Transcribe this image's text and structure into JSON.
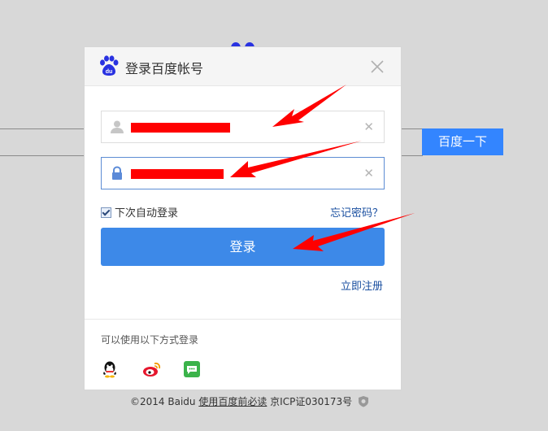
{
  "background": {
    "search_button_label": "百度一下",
    "footer": {
      "copyright": "©2014 Baidu",
      "link": "使用百度前必读",
      "icp": "京ICP证030173号"
    }
  },
  "dialog": {
    "title": "登录百度帐号",
    "username": {
      "value": "",
      "icon": "user-icon",
      "redacted": true
    },
    "password": {
      "value": "",
      "icon": "lock-icon",
      "redacted": true
    },
    "remember_label": "下次自动登录",
    "remember_checked": true,
    "forgot_label": "忘记密码？",
    "login_label": "登录",
    "register_label": "立即注册",
    "alt_login_text": "可以使用以下方式登录",
    "social": [
      "qq-icon",
      "weibo-icon",
      "wechat-icon"
    ]
  },
  "colors": {
    "accent": "#3d89e8",
    "search_button": "#3385ff",
    "link": "#1a4fa0",
    "annotation": "#ff0000"
  }
}
